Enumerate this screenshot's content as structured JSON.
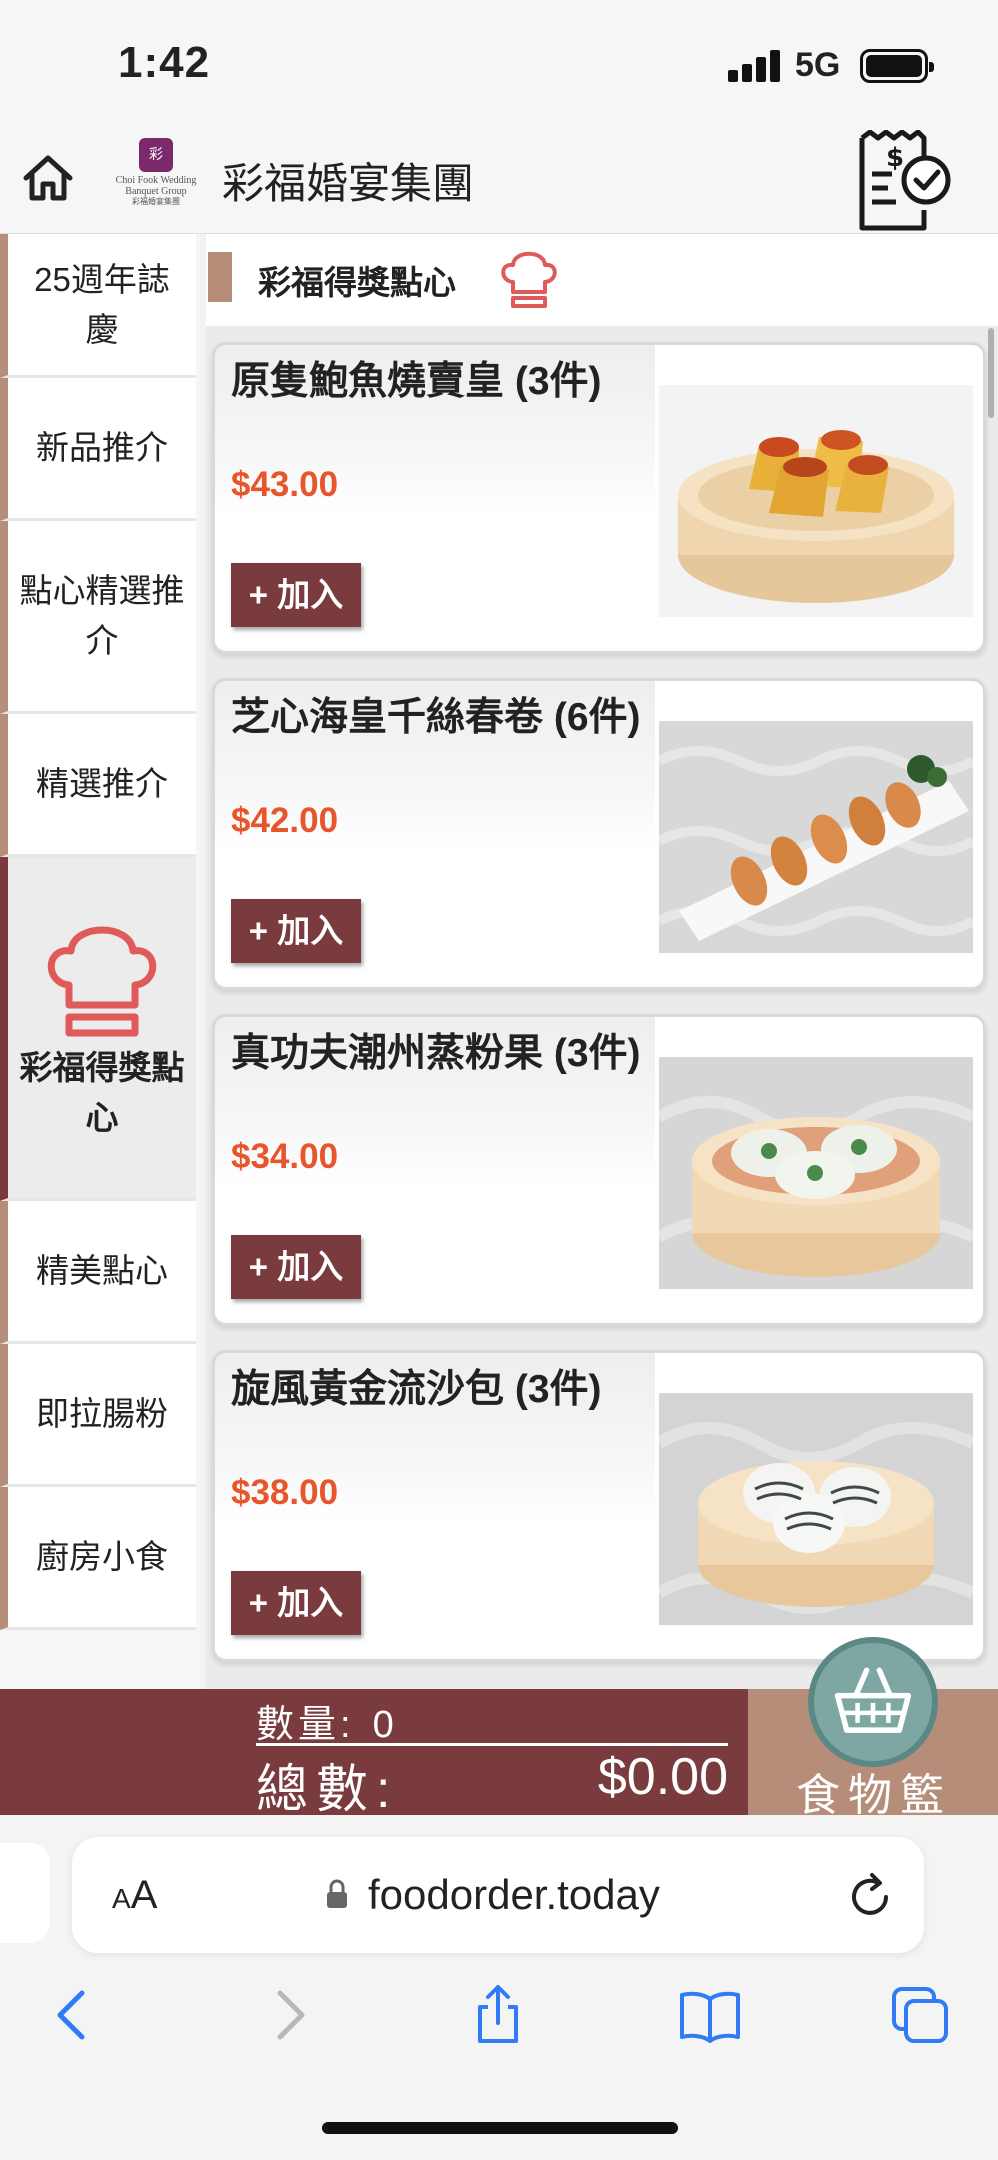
{
  "status": {
    "time": "1:42",
    "network": "5G",
    "battery_level": 1.0
  },
  "header": {
    "brand": "彩福婚宴集團",
    "logo_en": "Choi Fook Wedding Banquet Group",
    "logo_zh": "彩福婚宴集團",
    "logo_mark": "彩福"
  },
  "sidebar": {
    "items": [
      {
        "label": "25週年誌慶",
        "active": false
      },
      {
        "label": "新品推介",
        "active": false
      },
      {
        "label": "點心精選推介",
        "active": false
      },
      {
        "label": "精選推介",
        "active": false
      },
      {
        "label": "彩福得獎點心",
        "active": true
      },
      {
        "label": "精美點心",
        "active": false
      },
      {
        "label": "即拉腸粉",
        "active": false
      },
      {
        "label": "廚房小食",
        "active": false
      }
    ]
  },
  "section": {
    "title": "彩福得獎點心"
  },
  "products": [
    {
      "name": "原隻鮑魚燒賣皇 (3件)",
      "price": "$43.00",
      "add_label": "+ 加入",
      "image": "siu-mai-steamer"
    },
    {
      "name": "芝心海皇千絲春卷 (6件)",
      "price": "$42.00",
      "add_label": "+ 加入",
      "image": "spring-rolls-plate"
    },
    {
      "name": "真功夫潮州蒸粉果 (3件)",
      "price": "$34.00",
      "add_label": "+ 加入",
      "image": "chiuchow-dumplings-steamer"
    },
    {
      "name": "旋風黃金流沙包 (3件)",
      "price": "$38.00",
      "add_label": "+ 加入",
      "image": "custard-buns-steamer"
    }
  ],
  "cart": {
    "qty_label": "數量:",
    "qty_value": "0",
    "total_label": "總數:",
    "total_value": "$0.00",
    "basket_label": "食物籃"
  },
  "browser": {
    "aa_label": "AA",
    "url": "foodorder.today"
  },
  "colors": {
    "accent": "#7a3b3e",
    "tan": "#b58d78",
    "price": "#e8552a",
    "basket": "#7ea7a4"
  }
}
